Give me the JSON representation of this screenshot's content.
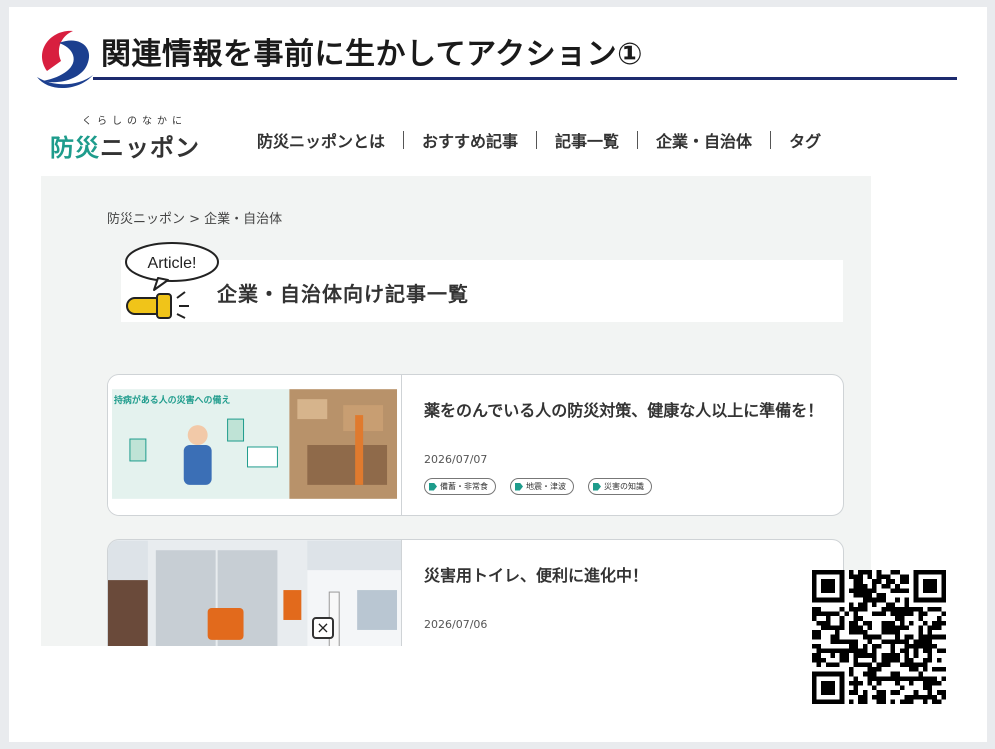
{
  "slide": {
    "title": "関連情報を事前に生かしてアクション①"
  },
  "site": {
    "brand_small": "くらしのなかに",
    "brand_part1": "防災",
    "brand_part2": "ニッポン",
    "nav": [
      "防災ニッポンとは",
      "おすすめ記事",
      "記事一覧",
      "企業・自治体",
      "タグ"
    ]
  },
  "page": {
    "breadcrumb": "防災ニッポン > 企業・自治体",
    "badge": "Article!",
    "heading": "企業・自治体向け記事一覧"
  },
  "articles": [
    {
      "title": "薬をのんでいる人の防災対策、健康な人以上に準備を！",
      "date": "2026/07/07",
      "thumb_caption": "持病がある人の災害への備え",
      "tags": [
        "備蓄・非常食",
        "地震・津波",
        "災害の知識"
      ]
    },
    {
      "title": "災害用トイレ、便利に進化中！",
      "date": "2026/07/06"
    }
  ],
  "overlay": {
    "close_label": "×"
  },
  "colors": {
    "accent": "#1e9c8c",
    "title_rule": "#1c2a6e",
    "logo_red": "#d81f3f",
    "logo_blue": "#1c3f8f"
  }
}
